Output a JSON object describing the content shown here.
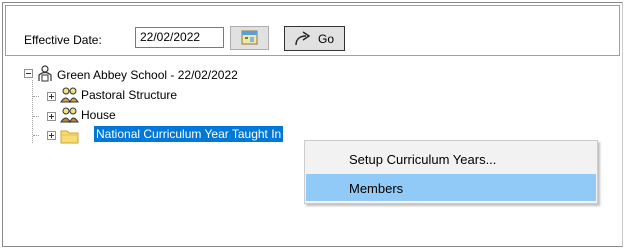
{
  "toolbar": {
    "effective_date_label": "Effective Date:",
    "effective_date_value": "22/02/2022",
    "go_label": "Go"
  },
  "tree": {
    "root": {
      "label": "Green Abbey School - 22/02/2022",
      "icon": "school-people-icon"
    },
    "children": [
      {
        "label": "Pastoral Structure",
        "icon": "pastoral-group-icon"
      },
      {
        "label": "House",
        "icon": "house-group-icon"
      },
      {
        "label": "National Curriculum Year Taught In",
        "icon": "folder-icon",
        "selected": true
      }
    ]
  },
  "context_menu": {
    "items": [
      {
        "label": "Setup Curriculum Years...",
        "highlighted": false
      },
      {
        "label": "Members",
        "highlighted": true
      }
    ]
  },
  "colors": {
    "selection": "#0078d7",
    "menu_highlight": "#91c9f7",
    "menu_background": "#f2f2f2"
  }
}
